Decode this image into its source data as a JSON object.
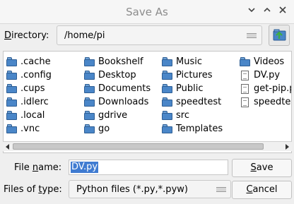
{
  "window": {
    "title": "Save As",
    "controls": [
      "chevron-down-icon",
      "chevron-up-icon",
      "close-icon"
    ]
  },
  "directory": {
    "label_u": "D",
    "label_rest": "irectory:",
    "value": "/home/pi",
    "up_icon": "folder-up-icon"
  },
  "files": {
    "columns": [
      [
        {
          "name": ".cache",
          "type": "folder"
        },
        {
          "name": ".config",
          "type": "folder"
        },
        {
          "name": ".cups",
          "type": "folder"
        },
        {
          "name": ".idlerc",
          "type": "folder"
        },
        {
          "name": ".local",
          "type": "folder"
        },
        {
          "name": ".vnc",
          "type": "folder"
        }
      ],
      [
        {
          "name": "Bookshelf",
          "type": "folder"
        },
        {
          "name": "Desktop",
          "type": "folder"
        },
        {
          "name": "Documents",
          "type": "folder"
        },
        {
          "name": "Downloads",
          "type": "folder"
        },
        {
          "name": "gdrive",
          "type": "folder"
        },
        {
          "name": "go",
          "type": "folder"
        }
      ],
      [
        {
          "name": "Music",
          "type": "folder"
        },
        {
          "name": "Pictures",
          "type": "folder"
        },
        {
          "name": "Public",
          "type": "folder"
        },
        {
          "name": "speedtest",
          "type": "folder"
        },
        {
          "name": "src",
          "type": "folder"
        },
        {
          "name": "Templates",
          "type": "folder"
        }
      ],
      [
        {
          "name": "Videos",
          "type": "folder"
        },
        {
          "name": "DV.py",
          "type": "file"
        },
        {
          "name": "get-pip.p",
          "type": "file"
        },
        {
          "name": "speedte",
          "type": "file"
        }
      ]
    ]
  },
  "filename": {
    "label_pre": "File ",
    "label_u": "n",
    "label_post": "ame:",
    "value": "DV.py"
  },
  "filetype": {
    "label_pre": "Files of ",
    "label_u": "t",
    "label_post": "ype:",
    "value": "Python files (*.py,*.pyw)"
  },
  "buttons": {
    "save_u": "S",
    "save_rest": "ave",
    "cancel_u": "C",
    "cancel_rest": "ancel"
  }
}
